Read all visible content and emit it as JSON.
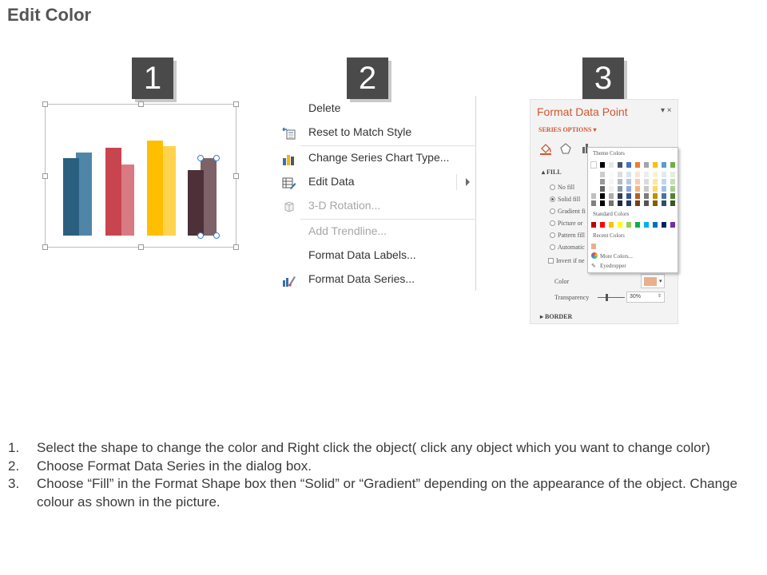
{
  "title": "Edit Color",
  "steps": [
    {
      "number": "1"
    },
    {
      "number": "2"
    },
    {
      "number": "3"
    }
  ],
  "chart_data": {
    "type": "bar",
    "categories": [
      "",
      "",
      "",
      ""
    ],
    "series": [
      {
        "values": [
          97,
          110,
          119,
          82
        ],
        "colors": [
          "#2b5f80",
          "#c84550",
          "#ffbf00",
          "#4d3038"
        ]
      },
      {
        "values": [
          104,
          89,
          112,
          97
        ],
        "colors": [
          "#4f86a8",
          "#d97a83",
          "#ffd34d",
          "#7d6268"
        ]
      }
    ]
  },
  "context_menu": {
    "items": [
      {
        "label": "Delete",
        "icon": "",
        "disabled": false
      },
      {
        "label": "Reset to Match Style",
        "icon": "reset-style-icon",
        "disabled": false
      },
      {
        "label": "Change Series Chart Type...",
        "icon": "bar-chart-icon",
        "disabled": false
      },
      {
        "label": "Edit Data",
        "icon": "edit-data-icon",
        "disabled": false,
        "submenu": true
      },
      {
        "label": "3-D Rotation...",
        "icon": "3d-rotation-icon",
        "disabled": true
      },
      {
        "label": "Add Trendline...",
        "icon": "",
        "disabled": true
      },
      {
        "label": "Format Data Labels...",
        "icon": "",
        "disabled": false
      },
      {
        "label": "Format Data Series...",
        "icon": "format-series-icon",
        "disabled": false
      }
    ]
  },
  "format_pane": {
    "title": "Format Data Point",
    "controls": "▾ ×",
    "series_options": "SERIES OPTIONS ▾",
    "fill_header": "▴ FILL",
    "fill_options": [
      {
        "label": "No fill",
        "selected": false
      },
      {
        "label": "Solid fill",
        "selected": true
      },
      {
        "label": "Gradient fi",
        "selected": false
      },
      {
        "label": "Picture or",
        "selected": false
      },
      {
        "label": "Pattern fill",
        "selected": false
      },
      {
        "label": "Automatic",
        "selected": false
      }
    ],
    "invert_label": "Invert if ne",
    "color_label": "Color",
    "transparency_label": "Transparency",
    "transparency_value": "30%",
    "border_header": "▸ BORDER",
    "selected_color": "#e9b08e",
    "popup": {
      "theme_colors_label": "Theme Colors",
      "standard_colors_label": "Standard Colors",
      "recent_colors_label": "Recent Colors",
      "more_colors_label": "More Colors...",
      "eyedropper_label": "Eyedropper",
      "theme_top": [
        "#ffffff",
        "#000000",
        "#e7e6e6",
        "#44546a",
        "#4472c4",
        "#ed7d31",
        "#a5a5a5",
        "#ffc000",
        "#5b9bd5",
        "#70ad47"
      ],
      "standard": [
        "#c00000",
        "#ff0000",
        "#ffc000",
        "#ffff00",
        "#92d050",
        "#00b050",
        "#00b0f0",
        "#0070c0",
        "#002060",
        "#7030a0"
      ],
      "recent": [
        "#e9b08e"
      ]
    }
  },
  "instructions": [
    {
      "number": "1.",
      "text": "Select the shape to change the color and Right click the object( click any object which you want to change color)"
    },
    {
      "number": "2.",
      "text": "Choose Format Data Series in the dialog box."
    },
    {
      "number": "3.",
      "text": "Choose “Fill” in the Format Shape box then “Solid” or “Gradient” depending on the appearance of the object. Change colour as shown in the picture."
    }
  ]
}
